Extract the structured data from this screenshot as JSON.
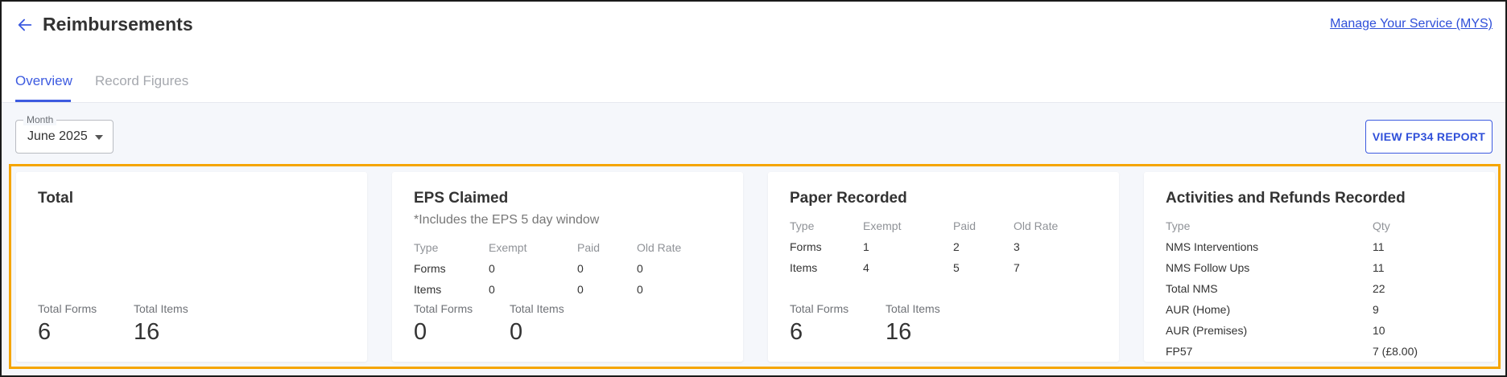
{
  "header": {
    "title": "Reimbursements",
    "mys_link": "Manage Your Service (MYS)",
    "tabs": [
      {
        "label": "Overview",
        "active": true
      },
      {
        "label": "Record Figures",
        "active": false
      }
    ]
  },
  "filters": {
    "month_label": "Month",
    "month_value": "June 2025",
    "report_button": "VIEW FP34 REPORT"
  },
  "cards": {
    "total": {
      "title": "Total",
      "total_forms_label": "Total Forms",
      "total_forms_value": "6",
      "total_items_label": "Total Items",
      "total_items_value": "16"
    },
    "eps": {
      "title": "EPS Claimed",
      "note": "*Includes the EPS 5 day window",
      "columns": [
        "Type",
        "Exempt",
        "Paid",
        "Old Rate"
      ],
      "rows": [
        [
          "Forms",
          "0",
          "0",
          "0"
        ],
        [
          "Items",
          "0",
          "0",
          "0"
        ]
      ],
      "total_forms_label": "Total Forms",
      "total_forms_value": "0",
      "total_items_label": "Total Items",
      "total_items_value": "0"
    },
    "paper": {
      "title": "Paper Recorded",
      "columns": [
        "Type",
        "Exempt",
        "Paid",
        "Old Rate"
      ],
      "rows": [
        [
          "Forms",
          "1",
          "2",
          "3"
        ],
        [
          "Items",
          "4",
          "5",
          "7"
        ]
      ],
      "total_forms_label": "Total Forms",
      "total_forms_value": "6",
      "total_items_label": "Total Items",
      "total_items_value": "16"
    },
    "activities": {
      "title": "Activities and Refunds Recorded",
      "columns": [
        "Type",
        "Qty"
      ],
      "rows": [
        [
          "NMS Interventions",
          "11"
        ],
        [
          "NMS Follow Ups",
          "11"
        ],
        [
          "Total NMS",
          "22"
        ],
        [
          "AUR (Home)",
          "9"
        ],
        [
          "AUR (Premises)",
          "10"
        ],
        [
          "FP57",
          "7 (£8.00)"
        ]
      ]
    }
  },
  "colors": {
    "accent": "#3d5be0",
    "highlight": "#f5a500",
    "muted": "#a5a8ae"
  }
}
